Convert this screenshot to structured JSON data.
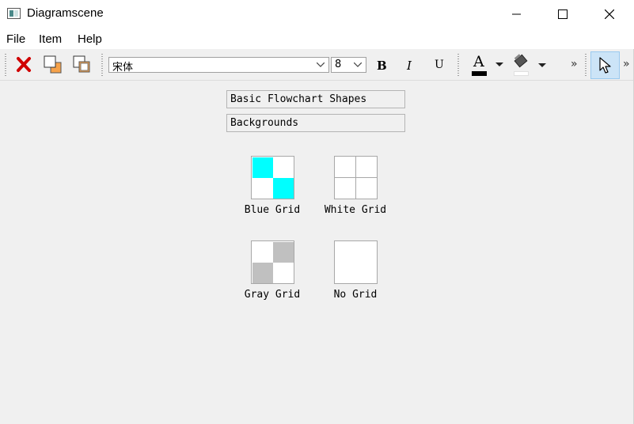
{
  "window": {
    "title": "Diagramscene",
    "minimize_icon": "minimize-icon",
    "maximize_icon": "maximize-icon",
    "close_icon": "close-icon"
  },
  "menubar": {
    "items": [
      {
        "label": "File"
      },
      {
        "label": "Item"
      },
      {
        "label": "Help"
      }
    ]
  },
  "toolbar": {
    "delete_icon": "delete-icon",
    "bring_to_front_icon": "bring-to-front-icon",
    "send_to_back_icon": "send-to-back-icon",
    "font_value": "宋体",
    "size_value": "8",
    "bold_label": "B",
    "italic_label": "I",
    "underline_label": "U",
    "font_color_letter": "A",
    "font_color": "#000000",
    "fill_color": "#ffffff",
    "more_label": "»",
    "pointer_icon": "pointer-icon"
  },
  "toolbox": {
    "sections": [
      {
        "label": "Basic Flowchart Shapes"
      },
      {
        "label": "Backgrounds"
      }
    ],
    "backgrounds": [
      {
        "label": "Blue Grid",
        "pattern": "blue",
        "color": "#00ffff"
      },
      {
        "label": "White Grid",
        "pattern": "white",
        "color": "#ffffff"
      },
      {
        "label": "Gray Grid",
        "pattern": "gray",
        "color": "#c0c0c0"
      },
      {
        "label": "No Grid",
        "pattern": "none",
        "color": "#ffffff"
      }
    ]
  }
}
